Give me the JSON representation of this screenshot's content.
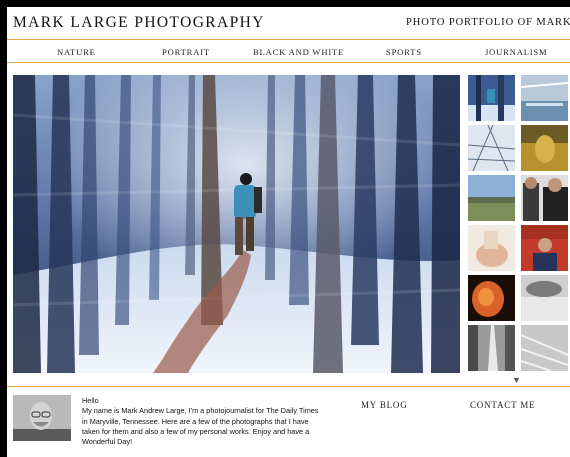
{
  "header": {
    "site_title": "MARK LARGE PHOTOGRAPHY",
    "tagline": "PHOTO PORTFOLIO OF MARK LARGE"
  },
  "nav": {
    "items": [
      {
        "label": "NATURE"
      },
      {
        "label": "PORTRAIT"
      },
      {
        "label": "BLACK AND WHITE"
      },
      {
        "label": "SPORTS"
      },
      {
        "label": "JOURNALISM"
      }
    ]
  },
  "colors": {
    "accent_line": "#e8a24a",
    "page_background": "#ffffff",
    "outer_background": "#000000",
    "text": "#111111"
  },
  "hero": {
    "icon": "featured-photo-forest-hiker"
  },
  "thumbnails": {
    "icon": "photo-thumbnail",
    "count": 12
  },
  "carousel": {
    "arrow_glyph": "▼"
  },
  "footer": {
    "greeting": "Hello",
    "bio": "My name is Mark Andrew Large, I'm a photojournalist for The Daily Times in Maryville, Tennessee. Here are a few of the photographs that I have taken for them and also a few of my personal works. Enjoy and have a Wonderful Day!",
    "blog_label": "MY BLOG",
    "contact_label": "CONTACT ME"
  }
}
